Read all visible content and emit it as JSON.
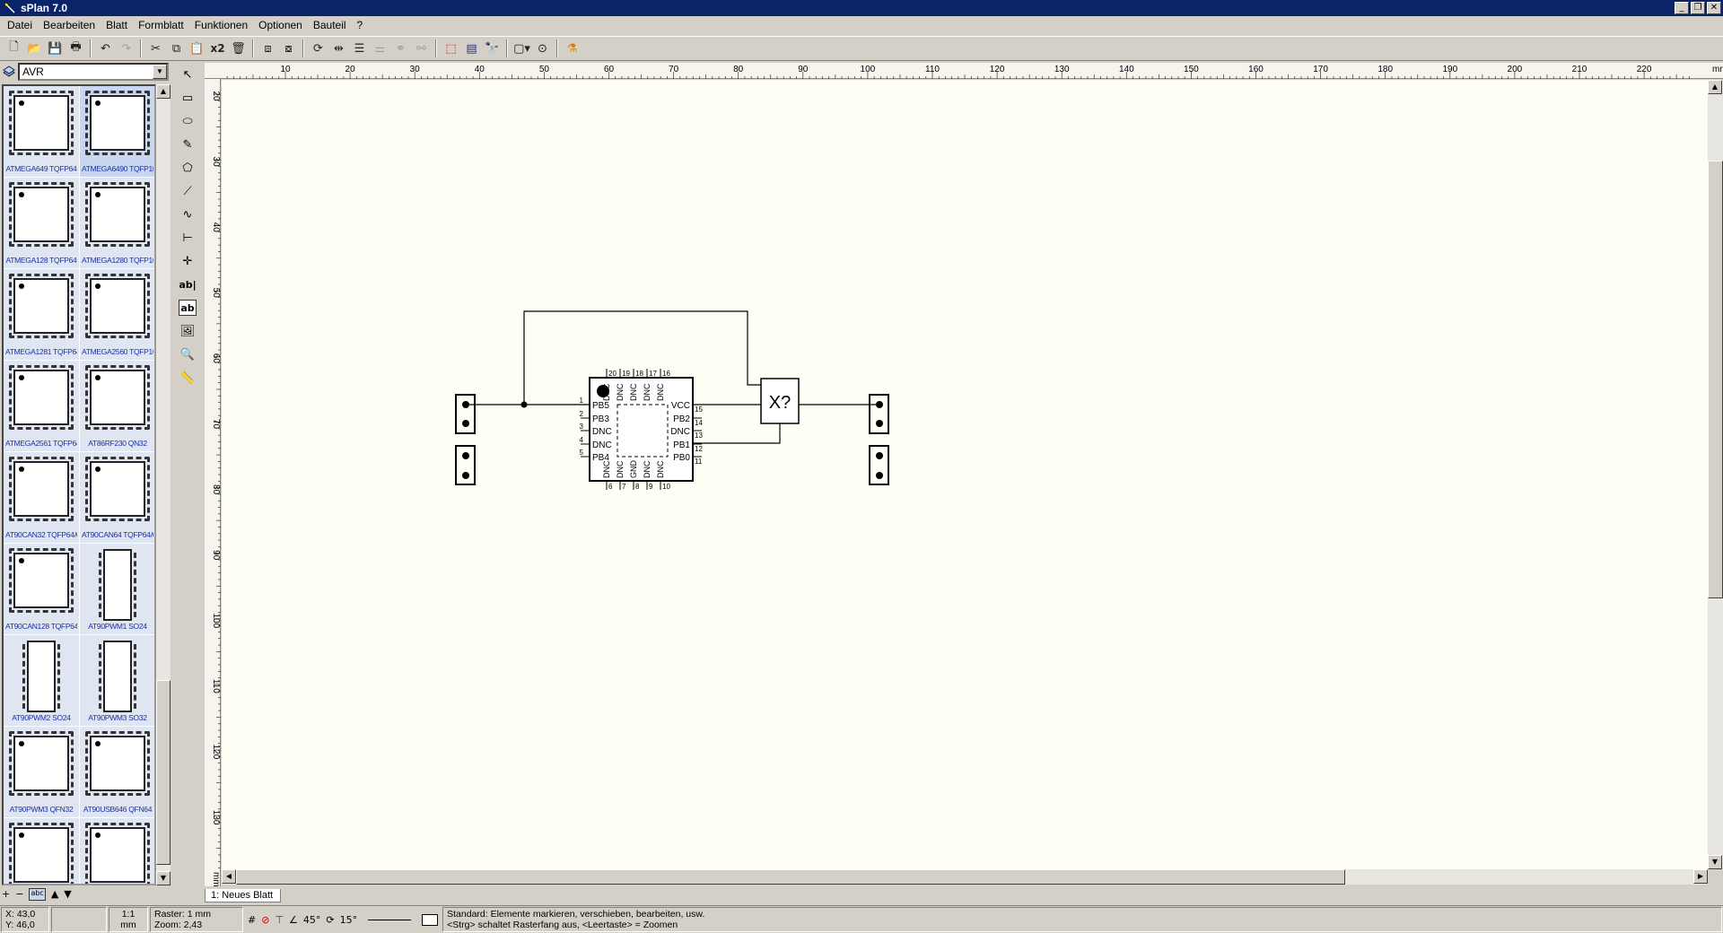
{
  "window": {
    "title": "sPlan 7.0",
    "buttons": [
      "_",
      "❐",
      "✕"
    ]
  },
  "menu": [
    "Datei",
    "Bearbeiten",
    "Blatt",
    "Formblatt",
    "Funktionen",
    "Optionen",
    "Bauteil",
    "?"
  ],
  "toolbar": {
    "groups": [
      [
        "new-icon",
        "open-icon",
        "save-icon",
        "print-icon"
      ],
      [
        "undo-icon",
        "redo-icon"
      ],
      [
        "cut-icon",
        "copy-icon",
        "paste-icon",
        "duplicate-icon",
        "delete-icon"
      ],
      [
        "to-front-icon",
        "to-back-icon"
      ],
      [
        "rotate-icon",
        "mirror-icon",
        "align-icon",
        "distribute-icon",
        "group-icon",
        "ungroup-icon"
      ],
      [
        "numbering-icon",
        "bom-icon",
        "find-icon"
      ],
      [
        "page-icon",
        "zoom-icon",
        "magic-icon"
      ]
    ],
    "duplicate_label": "x2"
  },
  "library": {
    "selected": "AVR",
    "items": [
      {
        "label": "ATMEGA649 TQFP64",
        "kind": "qfp",
        "selected": false
      },
      {
        "label": "ATMEGA6490 TQFP100",
        "kind": "qfp",
        "selected": true
      },
      {
        "label": "ATMEGA128 TQFP64",
        "kind": "qfp",
        "selected": false
      },
      {
        "label": "ATMEGA1280 TQFP100",
        "kind": "qfp",
        "selected": false
      },
      {
        "label": "ATMEGA1281 TQFP64",
        "kind": "qfp",
        "selected": false
      },
      {
        "label": "ATMEGA2560 TQFP100",
        "kind": "qfp",
        "selected": false
      },
      {
        "label": "ATMEGA2561 TQFP64",
        "kind": "qfp",
        "selected": false
      },
      {
        "label": "AT86RF230 QN32",
        "kind": "qfp",
        "selected": false
      },
      {
        "label": "AT90CAN32 TQFP64/QFN64",
        "kind": "qfp",
        "selected": false
      },
      {
        "label": "AT90CAN64 TQFP64/QFN64",
        "kind": "qfp",
        "selected": false
      },
      {
        "label": "AT90CAN128 TQFP64/QFN64",
        "kind": "qfp",
        "selected": false
      },
      {
        "label": "AT90PWM1 SO24",
        "kind": "so",
        "selected": false
      },
      {
        "label": "AT90PWM2 SO24",
        "kind": "so",
        "selected": false
      },
      {
        "label": "AT90PWM3 SO32",
        "kind": "so",
        "selected": false
      },
      {
        "label": "AT90PWM3 QFN32",
        "kind": "qfp",
        "selected": false
      },
      {
        "label": "AT90USB646 QFN64",
        "kind": "qfp",
        "selected": false
      },
      {
        "label": "",
        "kind": "qfp",
        "selected": false
      },
      {
        "label": "",
        "kind": "qfp",
        "selected": false
      }
    ],
    "footer": [
      "+",
      "−",
      "abc",
      "▲",
      "▼"
    ]
  },
  "tools": [
    "pointer-icon",
    "rectangle-icon",
    "ellipse-icon",
    "pen-icon",
    "polygon-icon",
    "line-icon",
    "bezier-icon",
    "dimension-icon",
    "junction-icon",
    "text-icon",
    "textbox-icon",
    "image-icon",
    "zoom-icon",
    "ruler-icon"
  ],
  "tool_text": {
    "text": "ab|",
    "textbox": "ab"
  },
  "rulers": {
    "unit": "mm",
    "h_ticks": [
      "10",
      "20",
      "30",
      "40",
      "50",
      "60",
      "70",
      "80",
      "90",
      "100",
      "110",
      "120",
      "130",
      "140",
      "150",
      "160",
      "170",
      "180",
      "190",
      "200",
      "210",
      "220"
    ],
    "v_ticks": [
      "20",
      "30",
      "40",
      "50",
      "60",
      "70",
      "80",
      "90",
      "100",
      "110",
      "120",
      "130"
    ]
  },
  "schematic": {
    "ic": {
      "top_pin_numbers": [
        "20",
        "19",
        "18",
        "17",
        "16"
      ],
      "bottom_pin_numbers": [
        "6",
        "7",
        "8",
        "9",
        "10"
      ],
      "left_pins": [
        "PB5",
        "PB3",
        "DNC",
        "DNC",
        "PB4"
      ],
      "left_pin_numbers": [
        "1",
        "2",
        "3",
        "4",
        "5"
      ],
      "right_pins": [
        "VCC",
        "PB2",
        "DNC",
        "PB1",
        "PB0"
      ],
      "right_pin_numbers": [
        "15",
        "14",
        "13",
        "12",
        "11"
      ],
      "top_pin_names": [
        "DNC",
        "DNC",
        "DNC",
        "DNC",
        "DNC"
      ],
      "bottom_pin_names": [
        "DNC",
        "DNC",
        "GND",
        "DNC",
        "DNC"
      ]
    },
    "box_label": "X?"
  },
  "tab": "1: Neues Blatt",
  "status": {
    "x": "X: 43,0",
    "y": "Y: 46,0",
    "scale": "1:1",
    "scale_unit": "mm",
    "raster": "Raster: 1 mm",
    "zoom": "Zoom:   2,43",
    "angle1": "45°",
    "angle2": "15°",
    "hint1": "Standard: Elemente markieren, verschieben, bearbeiten, usw.",
    "hint2": "<Strg> schaltet Rasterfang aus, <Leertaste> = Zoomen"
  }
}
